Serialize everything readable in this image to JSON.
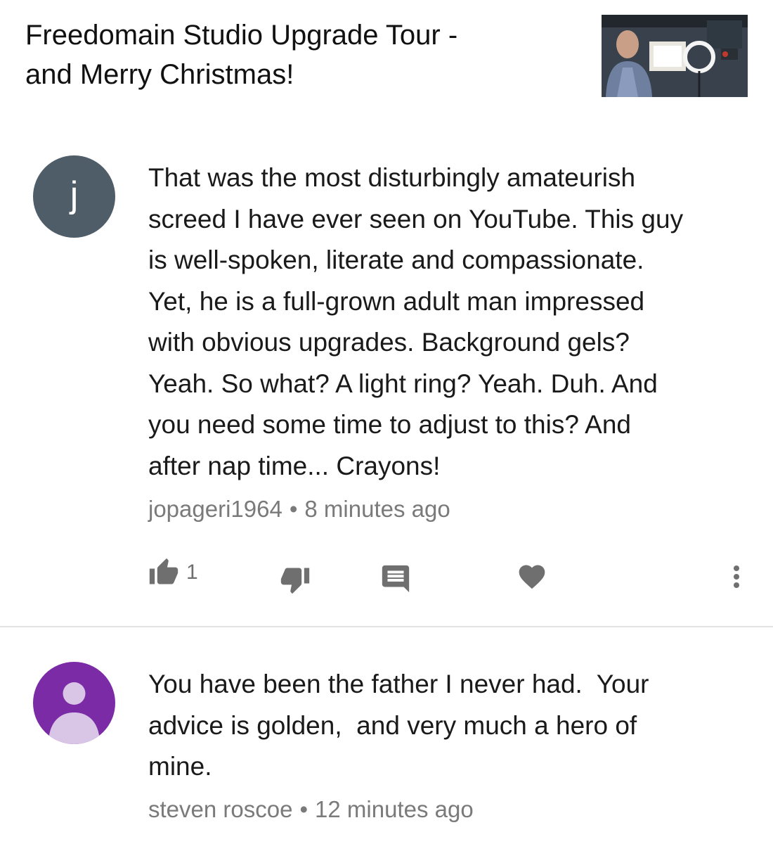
{
  "video": {
    "title_line1": "Freedomain Studio Upgrade Tour -",
    "title_line2": "and Merry Christmas!"
  },
  "comments": [
    {
      "avatar_letter": "j",
      "avatar_color": "#4f5d68",
      "text_lines": [
        "That was the most disturbingly amateurish",
        "screed I have ever seen on YouTube. This guy",
        "is well-spoken, literate and compassionate.",
        "Yet, he is a full-grown adult man impressed",
        "with obvious upgrades. Background gels?",
        "Yeah. So what? A light ring? Yeah. Duh. And",
        "you need some time to adjust to this? And",
        "after nap time... Crayons!"
      ],
      "author": "jopageri1964",
      "separator": "•",
      "time": "8 minutes ago",
      "like_count": "1",
      "icons": [
        "thumbs-up-icon",
        "thumbs-down-icon",
        "reply-icon",
        "heart-icon",
        "more-vert-icon"
      ]
    },
    {
      "avatar_icon": "person-icon",
      "avatar_color": "#7b2ba6",
      "text_lines": [
        "You have been the father I never had.  Your",
        "advice is golden,  and very much a hero of",
        "mine."
      ],
      "author": "steven roscoe",
      "separator": "•",
      "time": "12 minutes ago"
    }
  ]
}
